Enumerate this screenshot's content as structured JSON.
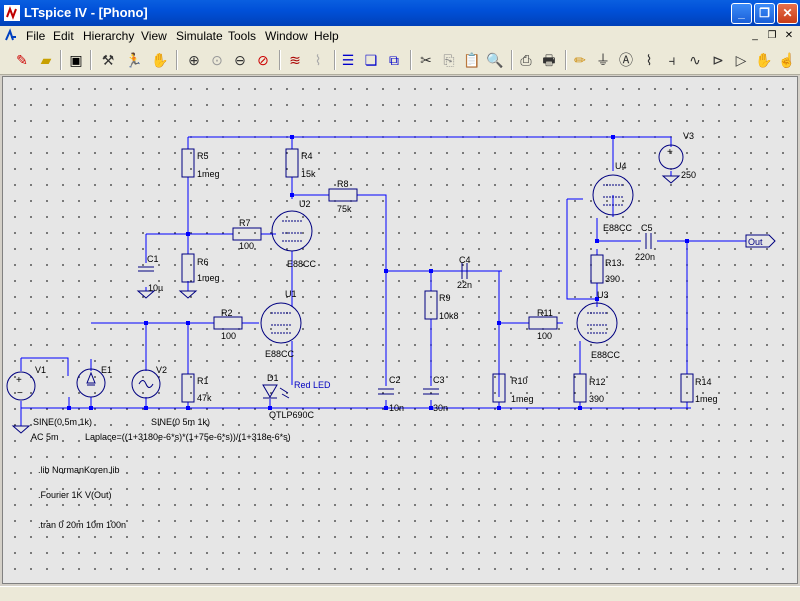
{
  "window": {
    "title": "LTspice IV - [Phono]"
  },
  "menu": {
    "items": [
      "File",
      "Edit",
      "Hierarchy",
      "View",
      "Simulate",
      "Tools",
      "Window",
      "Help"
    ]
  },
  "toolbar": {
    "icons": [
      "new-schematic-icon",
      "open-icon",
      "save-icon",
      "control-panel-icon",
      "run-icon",
      "halt-icon",
      "zoom-in-icon",
      "zoom-pan-icon",
      "zoom-out-icon",
      "zoom-cancel-icon",
      "autorange-icon",
      "view-fft-icon",
      "tile-icon",
      "cascade-icon",
      "close-window-icon",
      "cut-icon",
      "copy-icon",
      "paste-icon",
      "find-icon",
      "print-setup-icon",
      "print-icon",
      "draw-wire-icon",
      "ground-icon",
      "label-net-icon",
      "resistor-icon",
      "capacitor-icon",
      "inductor-icon",
      "diode-icon",
      "component-icon",
      "move-icon",
      "drag-icon"
    ]
  },
  "schematic": {
    "parts": {
      "r5": {
        "name": "R5",
        "value": "1meg"
      },
      "r4": {
        "name": "R4",
        "value": "15k"
      },
      "r8": {
        "name": "R8",
        "value": "75k"
      },
      "r7": {
        "name": "R7",
        "value": "100"
      },
      "r6": {
        "name": "R6",
        "value": "1meg"
      },
      "c1": {
        "name": "C1",
        "value": "10µ"
      },
      "u2": {
        "name": "U2",
        "value": "E88CC"
      },
      "u1": {
        "name": "U1",
        "value": "E88CC"
      },
      "r2": {
        "name": "R2",
        "value": "100"
      },
      "d1": {
        "name": "D1",
        "value": "QTLP690C",
        "label": "Red LED"
      },
      "v1": {
        "name": "V1",
        "value": "SINE(0 5m 1k)",
        "ac": "AC 5m"
      },
      "e1": {
        "name": "E1",
        "value": "Laplace=((1+3180e-6*s)*(1+75e-6*s))/(1+318e-6*s)"
      },
      "v2": {
        "name": "V2",
        "value": "SINE(0 5m 1k)"
      },
      "r1": {
        "name": "R1",
        "value": "47k"
      },
      "c2": {
        "name": "C2",
        "value": "10n"
      },
      "c4": {
        "name": "C4",
        "value": "22n"
      },
      "r9": {
        "name": "R9",
        "value": "10k8"
      },
      "c3": {
        "name": "C3",
        "value": "30n"
      },
      "r10": {
        "name": "R10",
        "value": "1meg"
      },
      "r11": {
        "name": "R11",
        "value": "100"
      },
      "v3": {
        "name": "V3",
        "value": "250"
      },
      "u4": {
        "name": "U4",
        "value": "E88CC"
      },
      "c5": {
        "name": "C5",
        "value": "220n"
      },
      "r13": {
        "name": "R13",
        "value": "390"
      },
      "u3": {
        "name": "U3",
        "value": "E88CC"
      },
      "r12": {
        "name": "R12",
        "value": "390"
      },
      "r14": {
        "name": "R14",
        "value": "1meg"
      }
    },
    "out_label": "Out",
    "directives": [
      ".lib NormanKoren.lib",
      ".Fourier 1K V(Out)",
      ".tran 0 20m 10m 100n"
    ]
  },
  "colors": {
    "wire": "#0000ff",
    "part": "#000080",
    "text": "#000000",
    "title_bar": "#0054e3"
  }
}
